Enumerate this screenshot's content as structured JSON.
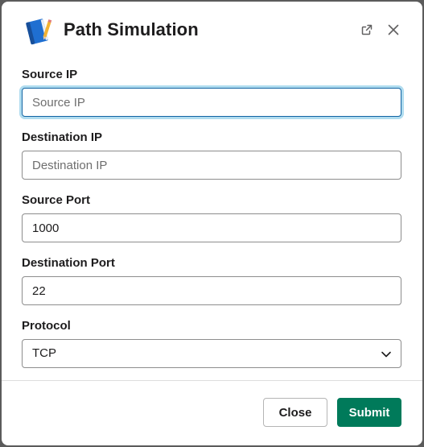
{
  "dialog": {
    "title": "Path Simulation",
    "icon": "notebook-icon"
  },
  "fields": [
    {
      "label": "Source IP",
      "value": "",
      "placeholder": "Source IP",
      "focused": true
    },
    {
      "label": "Destination IP",
      "value": "",
      "placeholder": "Destination IP",
      "focused": false
    },
    {
      "label": "Source Port",
      "value": "1000",
      "placeholder": "",
      "focused": false
    },
    {
      "label": "Destination Port",
      "value": "22",
      "placeholder": "",
      "focused": false
    }
  ],
  "protocol": {
    "label": "Protocol",
    "selected": "TCP"
  },
  "footer": {
    "close_label": "Close",
    "submit_label": "Submit"
  },
  "colors": {
    "submit_bg": "#007a5a",
    "focus_ring": "#1d9bd1",
    "text": "#1d1c1d"
  }
}
